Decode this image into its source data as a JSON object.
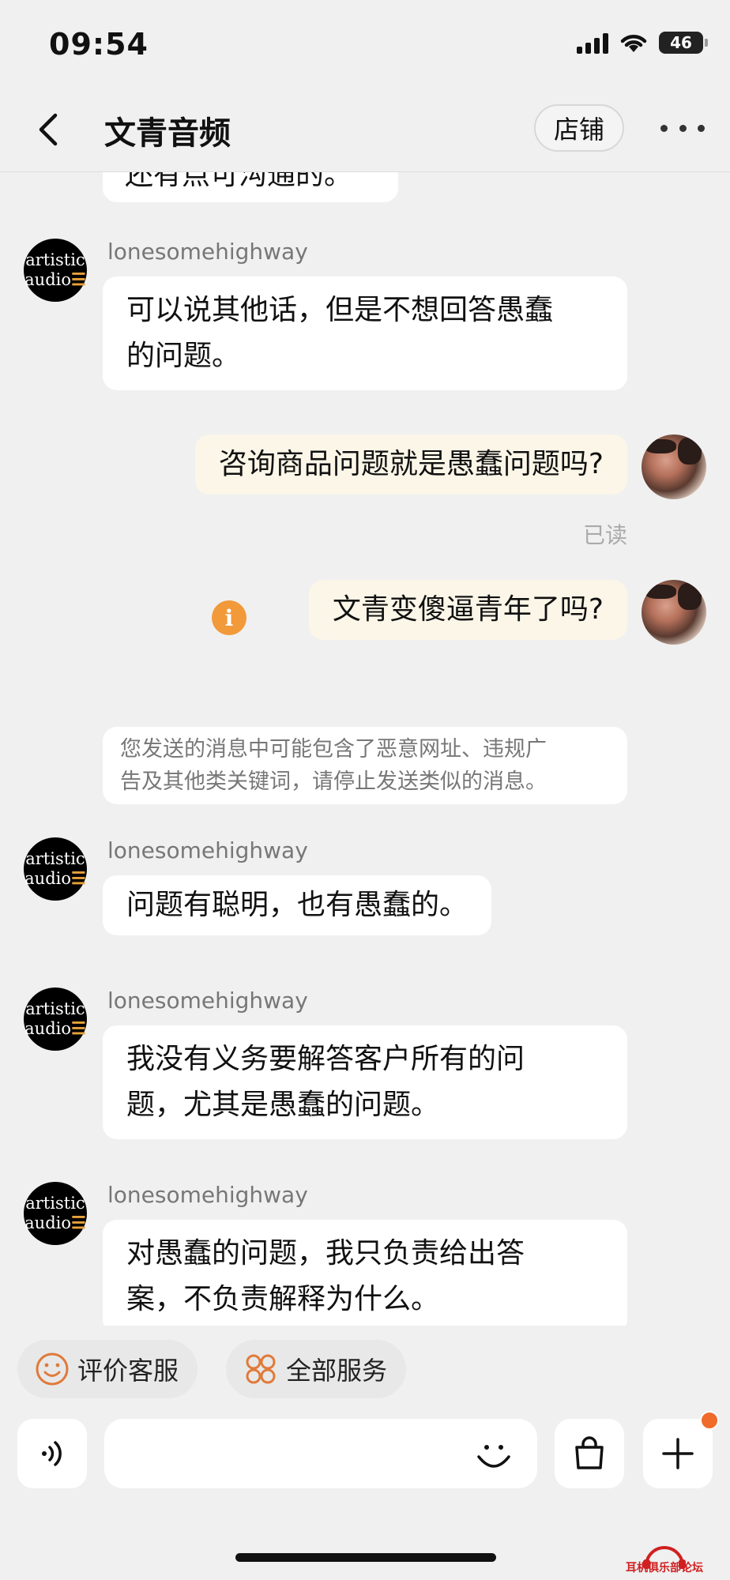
{
  "status_bar": {
    "time": "09:54",
    "battery": "46"
  },
  "nav": {
    "title": "文青音频",
    "shop_button": "店铺"
  },
  "chat": {
    "cut_message": "还有点可沟通的。",
    "shop_avatar": {
      "line1": "artistic",
      "line2": "audio",
      "mark": "☰"
    },
    "messages": [
      {
        "sender": "lonesomehighway",
        "lines": [
          "可以说其他话，但是不想回答愚蠢",
          "的问题。"
        ]
      },
      {
        "outgoing": "咨询商品问题就是愚蠢问题吗?",
        "read": "已读"
      },
      {
        "outgoing": "文青变傻逼青年了吗?",
        "warning": "i"
      },
      {
        "notice": [
          "您发送的消息中可能包含了恶意网址、违规广",
          "告及其他类关键词，请停止发送类似的消息。"
        ]
      },
      {
        "sender": "lonesomehighway",
        "lines": [
          "问题有聪明，也有愚蠢的。"
        ]
      },
      {
        "sender": "lonesomehighway",
        "lines": [
          "我没有义务要解答客户所有的问",
          "题，尤其是愚蠢的问题。"
        ]
      },
      {
        "sender": "lonesomehighway",
        "lines": [
          "对愚蠢的问题，我只负责给出答",
          "案，不负责解释为什么。"
        ]
      }
    ]
  },
  "quick_actions": {
    "rate_service": "评价客服",
    "all_services": "全部服务"
  },
  "input": {
    "placeholder": ""
  },
  "watermark": {
    "text": "耳机俱乐部论坛"
  },
  "colors": {
    "accent": "#f06a2a",
    "outgoing_bubble": "#fbf6e8",
    "warning": "#f2993a",
    "background": "#f0f0f0"
  },
  "icons": [
    "signal-icon",
    "wifi-icon",
    "battery-icon",
    "back-icon",
    "more-icon",
    "warning-icon",
    "smile-icon",
    "services-icon",
    "voice-icon",
    "emoji-icon",
    "bag-icon",
    "plus-icon"
  ]
}
